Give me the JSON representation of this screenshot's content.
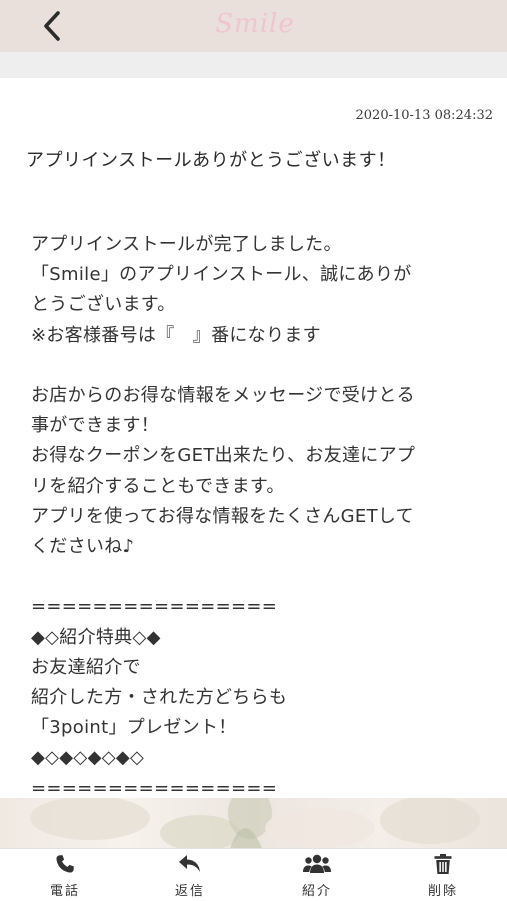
{
  "header": {
    "back_icon": "chevron-left-icon",
    "logo_text": "Smile"
  },
  "message": {
    "timestamp": "2020-10-13 08:24:32",
    "title": "アプリインストールありがとうございます！",
    "body": "アプリインストールが完了しました。\n「Smile」のアプリインストール、誠にありが\nとうございます。\n※お客様番号は『　』番になります\n\n お店からのお得な情報をメッセージで受けとる\n事ができます！\n お得なクーポンをGET出来たり、お友達にアプ\nリを紹介することもできます。\n アプリを使ってお得な情報をたくさんGETして\nくださいね♪\n\n ================\n◆◇紹介特典◇◆\nお友達紹介で\n紹介した方・された方どちらも\n「3point」プレゼント！\n◆◇◆◇◆◇◆◇\n================"
  },
  "tabbar": {
    "items": [
      {
        "label": "電話",
        "icon": "phone-icon"
      },
      {
        "label": "返信",
        "icon": "reply-icon"
      },
      {
        "label": "紹介",
        "icon": "users-icon"
      },
      {
        "label": "削除",
        "icon": "trash-icon"
      }
    ]
  },
  "colors": {
    "header_bg": "#e9dfdb",
    "logo": "#f1c5cf",
    "icon": "#333333"
  }
}
